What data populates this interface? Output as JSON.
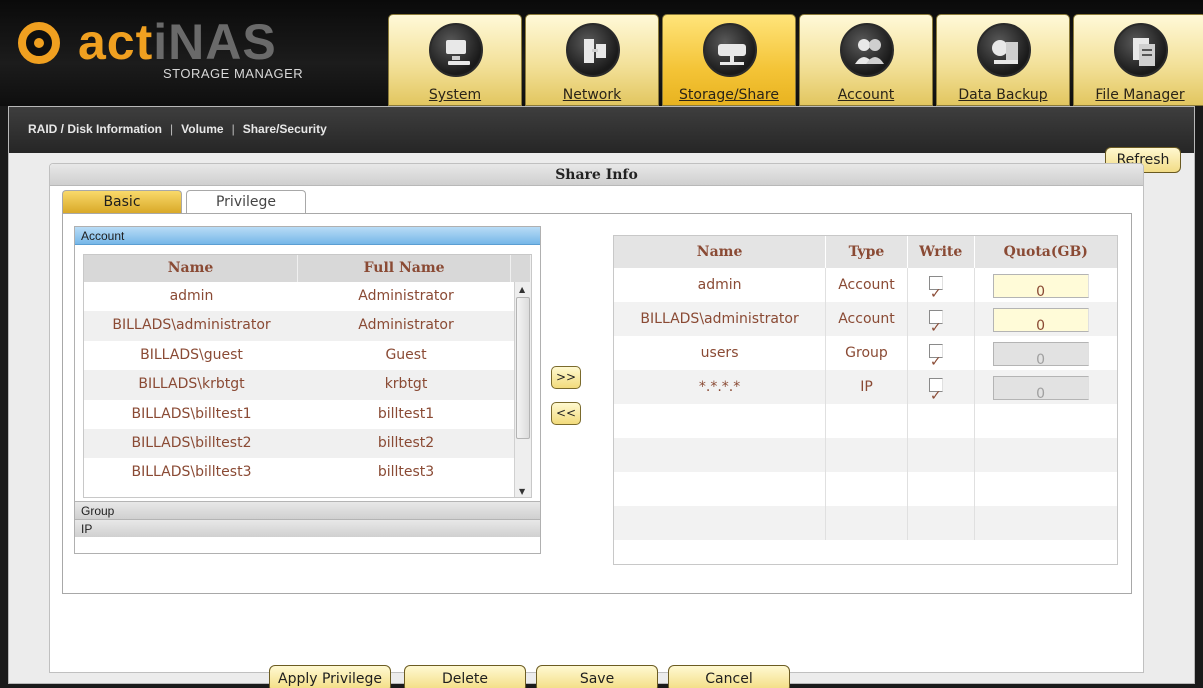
{
  "logo": {
    "brand_a": "act",
    "brand_b": "iNAS",
    "subtitle": "STORAGE MANAGER"
  },
  "nav": [
    {
      "label": "System",
      "icon": "computer-icon"
    },
    {
      "label": "Network",
      "icon": "network-icon"
    },
    {
      "label": "Storage/Share",
      "icon": "storage-icon",
      "active": true
    },
    {
      "label": "Account",
      "icon": "users-icon"
    },
    {
      "label": "Data Backup",
      "icon": "backup-icon"
    },
    {
      "label": "File Manager",
      "icon": "file-icon"
    }
  ],
  "breadcrumb": {
    "item1": "RAID / Disk Information",
    "item2": "Volume",
    "item3": "Share/Security",
    "sep": "|"
  },
  "refresh_label": "Refresh",
  "panel_title": "Share Info",
  "tabs": {
    "basic": "Basic",
    "privilege": "Privilege"
  },
  "accordion": {
    "account": "Account",
    "group": "Group",
    "ip": "IP"
  },
  "user_table": {
    "headers": {
      "name": "Name",
      "full_name": "Full Name"
    },
    "rows": [
      {
        "name": "admin",
        "full_name": "Administrator"
      },
      {
        "name": "BILLADS\\administrator",
        "full_name": "Administrator"
      },
      {
        "name": "BILLADS\\guest",
        "full_name": "Guest"
      },
      {
        "name": "BILLADS\\krbtgt",
        "full_name": "krbtgt"
      },
      {
        "name": "BILLADS\\billtest1",
        "full_name": "billtest1"
      },
      {
        "name": "BILLADS\\billtest2",
        "full_name": "billtest2"
      },
      {
        "name": "BILLADS\\billtest3",
        "full_name": "billtest3"
      }
    ]
  },
  "move": {
    "add": ">>",
    "remove": "<<"
  },
  "priv_table": {
    "headers": {
      "name": "Name",
      "type": "Type",
      "write": "Write",
      "quota": "Quota(GB)"
    },
    "rows": [
      {
        "name": "admin",
        "type": "Account",
        "write": "✓",
        "quota": "0",
        "editable": true
      },
      {
        "name": "BILLADS\\administrator",
        "type": "Account",
        "write": "✓",
        "quota": "0",
        "editable": true
      },
      {
        "name": "users",
        "type": "Group",
        "write": "✓",
        "quota": "0",
        "editable": false
      },
      {
        "name": "*.*.*.*",
        "type": "IP",
        "write": "✓",
        "quota": "0",
        "editable": false
      }
    ]
  },
  "buttons": {
    "apply": "Apply Privilege",
    "delete": "Delete",
    "save": "Save",
    "cancel": "Cancel"
  },
  "colors": {
    "accent_gold": "#f0a020",
    "tab_active": "#f4c437",
    "text_brown": "#8a4a34"
  }
}
